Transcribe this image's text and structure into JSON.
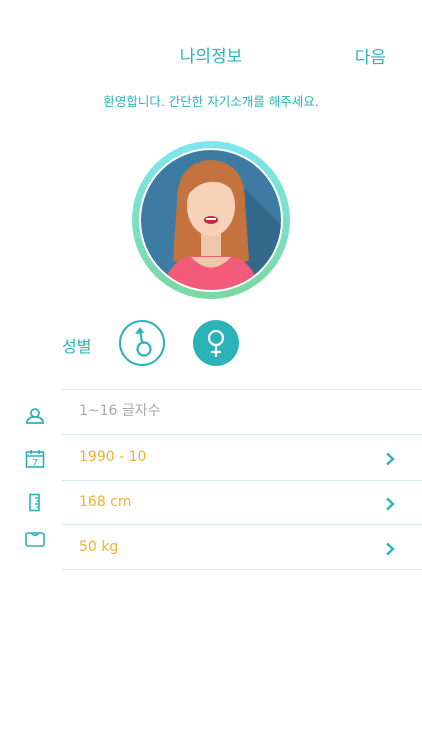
{
  "header": {
    "title": "나의정보",
    "next_label": "다음"
  },
  "welcome_text": "환영합니다. 간단한 자기소개를 해주세요.",
  "gender": {
    "label": "성별",
    "options": [
      "male",
      "female"
    ],
    "selected": "female"
  },
  "fields": {
    "nickname": {
      "placeholder": "1~16 글자수",
      "value": "",
      "icon": "user-icon"
    },
    "birth": {
      "value": "1990 - 10",
      "icon": "calendar-icon",
      "calendar_day": "7"
    },
    "height": {
      "value": "168 cm",
      "icon": "ruler-icon"
    },
    "weight": {
      "value": "50 kg",
      "icon": "scale-icon"
    }
  },
  "colors": {
    "accent": "#2bb3b8",
    "value": "#f0b233",
    "placeholder": "#a9a9a9",
    "divider": "#d4eaec"
  }
}
